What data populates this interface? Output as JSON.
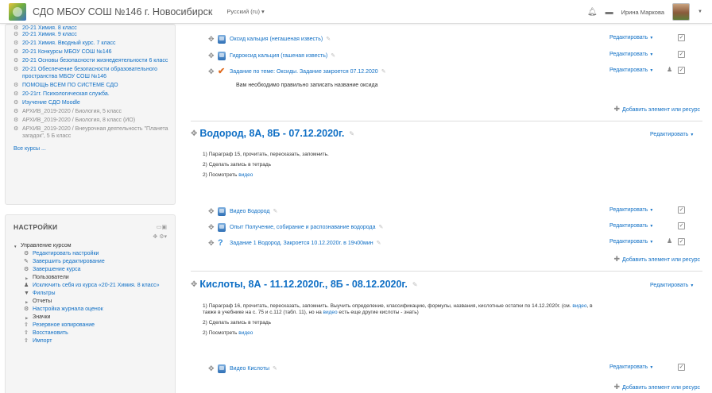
{
  "navbar": {
    "site_name": "СДО МБОУ СОШ №146 г. Новосибирск",
    "language": "Русский (ru) ▾",
    "user_name": "Ирина Маркова"
  },
  "courses_block": {
    "items": [
      {
        "label": "20-21 Химия. 8 класс",
        "dimmed": false
      },
      {
        "label": "20-21 Химия. 9 класс",
        "dimmed": false
      },
      {
        "label": "20-21 Химия. Вводный курс. 7 класс",
        "dimmed": false
      },
      {
        "label": "20-21 Конкурсы МБОУ СОШ №146",
        "dimmed": false
      },
      {
        "label": "20-21 Основы безопасности жизнедеятельности 6 класс",
        "dimmed": false
      },
      {
        "label": "20-21 Обеспечение безопасности образовательного пространства МБОУ СОШ №146",
        "dimmed": false
      },
      {
        "label": "ПОМОЩЬ ВСЕМ ПО СИСТЕМЕ СДО",
        "dimmed": false
      },
      {
        "label": "20-21гг. Психологическая служба.",
        "dimmed": false
      },
      {
        "label": "Изучение СДО Moodle",
        "dimmed": false
      },
      {
        "label": "АРХИВ_2019-2020 / Биология, 5 класс",
        "dimmed": true
      },
      {
        "label": "АРХИВ_2019-2020 / Биология, 8 класс (ИО)",
        "dimmed": true
      },
      {
        "label": "АРХИВ_2019-2020 / Внеурочная деятельность \"Планета загадок\", 5 Б класс",
        "dimmed": true
      }
    ],
    "all_courses": "Все курсы ..."
  },
  "settings_block": {
    "title": "НАСТРОЙКИ",
    "root": "Управление курсом",
    "items": [
      {
        "label": "Редактировать настройки",
        "icon": "⚙",
        "type": "link"
      },
      {
        "label": "Завершить редактирование",
        "icon": "✎",
        "type": "link"
      },
      {
        "label": "Завершение курса",
        "icon": "⚙",
        "type": "link"
      },
      {
        "label": "Пользователи",
        "icon": "",
        "type": "folder"
      },
      {
        "label": "Исключить себя из курса «20-21 Химия. 8 класс»",
        "icon": "👤",
        "type": "link"
      },
      {
        "label": "Фильтры",
        "icon": "▼",
        "type": "link"
      },
      {
        "label": "Отчеты",
        "icon": "",
        "type": "folder"
      },
      {
        "label": "Настройка журнала оценок",
        "icon": "⚙",
        "type": "link"
      },
      {
        "label": "Значки",
        "icon": "",
        "type": "folder"
      },
      {
        "label": "Резервное копирование",
        "icon": "⇧",
        "type": "link"
      },
      {
        "label": "Восстановить",
        "icon": "⇧",
        "type": "link"
      },
      {
        "label": "Импорт",
        "icon": "⇧",
        "type": "link"
      }
    ]
  },
  "main": {
    "edit_label": "Редактировать",
    "add_resource": "Добавить элемент или ресурс",
    "section0": {
      "activities": [
        {
          "label": "Оксид кальция (негашеная известь)",
          "type": "file"
        },
        {
          "label": "Гидроксид кальция (гашеная известь)",
          "type": "file"
        },
        {
          "label": "Задание по теме: Оксиды. Задание закроется 07.12.2020",
          "type": "assign"
        }
      ],
      "description": "Вам необходимо правильно записать название оксида"
    },
    "section1": {
      "title": "Водород, 8А, 8Б - 07.12.2020г.",
      "summary": [
        "1) Параграф 15, прочитать, пересказать, запомнить.",
        "2) Сделать запись в тетрадь",
        "2) Посмотреть "
      ],
      "video_link": "видео",
      "activities": [
        {
          "label": "Видео Водород",
          "type": "file"
        },
        {
          "label": "Опыт Получение, собирание и распознавание водорода",
          "type": "file"
        },
        {
          "label": "Задание 1 Водород. Закроется 10.12.2020г. в 19ч00мин",
          "type": "quiz"
        }
      ]
    },
    "section2": {
      "title": "Кислоты, 8А - 11.12.2020г., 8Б - 08.12.2020г.",
      "summary_line1_a": "1) Параграф 16, прочитать, пересказать, запомнить. Выучить определение, классификацию, формулы, названия, кислотные остатки по 14.12.2020г. (см. ",
      "summary_line1_link": "видео",
      "summary_line1_b": ", в",
      "summary_line2_a": "также в учебнике на с. 75 и с.112 (табл. 11), но на ",
      "summary_line2_link": "видео",
      "summary_line2_b": " есть еще другие кислоты - знать)",
      "summary_line3": "2) Сделать запись в тетрадь",
      "summary_line4": "2) Посмотреть ",
      "video_link": "видео",
      "activities": [
        {
          "label": "Видео Кислоты",
          "type": "file"
        }
      ]
    }
  }
}
